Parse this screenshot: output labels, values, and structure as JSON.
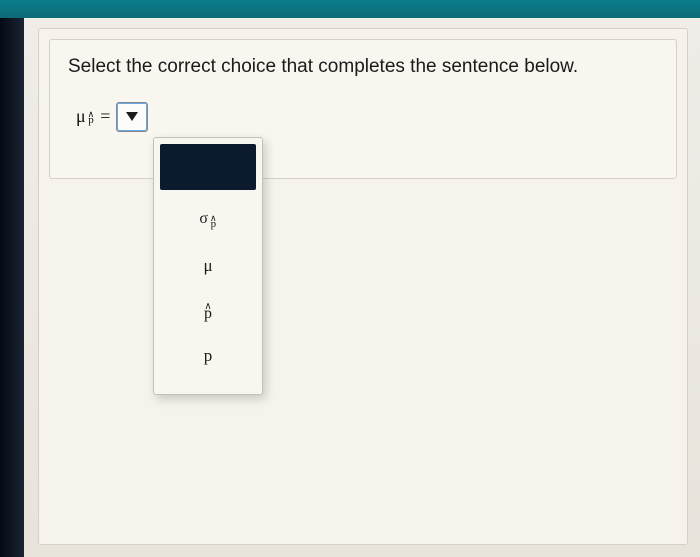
{
  "instruction": "Select the correct choice that completes the sentence below.",
  "equation": {
    "lhs_main": "μ",
    "lhs_sub_caret": "∧",
    "lhs_sub_base": "p",
    "equals": "="
  },
  "dropdown": {
    "selected_index": 0,
    "options": [
      {
        "type": "blank",
        "label": ""
      },
      {
        "type": "sigma_phat",
        "sigma": "σ",
        "caret": "∧",
        "base": "p"
      },
      {
        "type": "plain",
        "label": "μ"
      },
      {
        "type": "phat",
        "caret": "∧",
        "base": "p"
      },
      {
        "type": "plain",
        "label": "p"
      }
    ]
  }
}
